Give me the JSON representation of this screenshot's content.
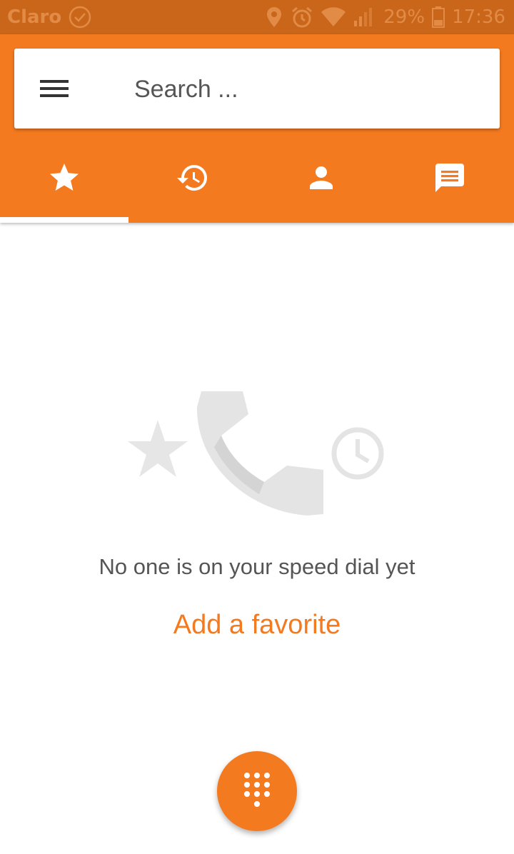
{
  "status_bar": {
    "carrier": "Claro",
    "battery": "29%",
    "time": "17:36",
    "icons": [
      "check-circle-icon",
      "location-icon",
      "alarm-icon",
      "wifi-icon",
      "signal-icon",
      "battery-icon"
    ]
  },
  "search": {
    "placeholder": "Search ..."
  },
  "tabs": [
    {
      "name": "favorites",
      "icon": "star-icon",
      "selected": true
    },
    {
      "name": "recents",
      "icon": "history-icon",
      "selected": false
    },
    {
      "name": "contacts",
      "icon": "person-icon",
      "selected": false
    },
    {
      "name": "messages",
      "icon": "message-icon",
      "selected": false
    }
  ],
  "empty_state": {
    "message": "No one is on your speed dial yet",
    "action": "Add a favorite",
    "illustration_icons": [
      "star-icon",
      "phone-icon",
      "clock-icon"
    ]
  },
  "fab": {
    "icon": "dialpad-icon"
  },
  "colors": {
    "accent": "#f47a20",
    "status_bar": "#c9661a",
    "text_secondary": "#555555"
  }
}
